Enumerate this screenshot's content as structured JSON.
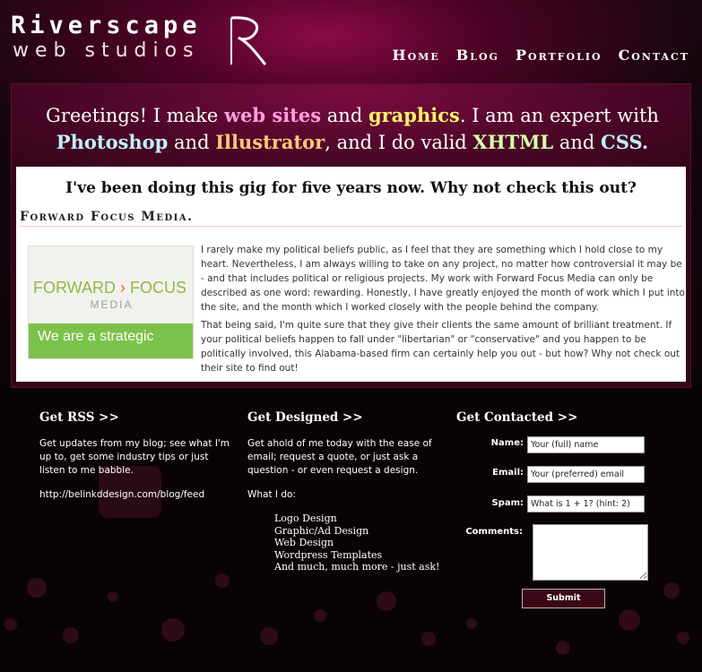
{
  "brand": {
    "name_top": "Riverscape",
    "name_bottom": "web studios",
    "logo_letter": "R"
  },
  "nav": {
    "items": [
      "Home",
      "Blog",
      "Portfolio",
      "Contact"
    ]
  },
  "hero": {
    "t1": "Greetings! I make ",
    "h1": "web sites",
    "t2": " and ",
    "h2": "graphics",
    "t3": ". I am an expert with ",
    "h3": "Photoshop",
    "t4": " and ",
    "h4": "Illustrator",
    "t5": ", and I do valid ",
    "h5": "XHTML",
    "t6": " and ",
    "h6": "CSS."
  },
  "feature": {
    "heading": "I've been doing this gig for five years now. Why not check this out?",
    "section_title": "Forward Focus Media.",
    "thumb": {
      "brand_left": "FORWARD",
      "brand_arrow": "›",
      "brand_right": "FOCUS",
      "brand_sub": "MEDIA",
      "tagline": "We are a strategic"
    },
    "para1": "I rarely make my political beliefs public, as I feel that they are something which I hold close to my heart. Nevertheless, I am always willing to take on any project, no matter how controversial it may be - and that includes political or religious projects. My work with Forward Focus Media can only be described as one word: rewarding. Honestly, I have greatly enjoyed the month of work which I put into the site, and the month which I worked closely with the people behind the company.",
    "para2": "That being said, I'm quite sure that they give their clients the same amount of brilliant treatment. If your political beliefs happen to fall under \"libertarian\" or \"conservative\" and you happen to be politically involved, this Alabama-based firm can certainly help you out - but how? Why not check out their site to find out!"
  },
  "footer": {
    "rss": {
      "title": "Get RSS >>",
      "text": "Get updates from my blog; see what I'm up to, get some industry tips or just listen to me babble.",
      "link": "http://belinkddesign.com/blog/feed"
    },
    "designed": {
      "title": "Get Designed >>",
      "text": "Get ahold of me today with the ease of email; request a quote, or just ask a question - or even request a design.",
      "what_label": "What I do:",
      "services": [
        "Logo Design",
        "Graphic/Ad Design",
        "Web Design",
        "Wordpress Templates",
        "And much, much more - just ask!"
      ]
    },
    "contact": {
      "title": "Get Contacted >>",
      "name_label": "Name:",
      "name_value": "Your (full) name",
      "email_label": "Email:",
      "email_value": "Your (preferred) email",
      "spam_label": "Spam:",
      "spam_value": "What is 1 + 1? (hint: 2)",
      "comments_label": "Comments:",
      "submit_label": "Submit"
    }
  },
  "colors": {
    "background": "#0a0306",
    "hero": "#4a0726",
    "accent_pink": "#ff9ee0",
    "accent_yellow": "#fff36a",
    "accent_cyan": "#bff0ff",
    "accent_orange": "#ffc77a",
    "accent_green": "#d6ffab"
  }
}
